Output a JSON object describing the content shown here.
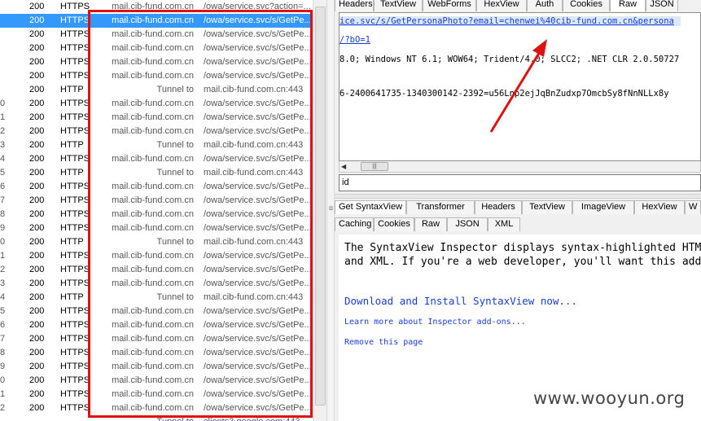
{
  "sessions": [
    {
      "id": "",
      "result": "200",
      "protocol": "HTTPS",
      "host": "mail.cib-fund.com.cn",
      "url": "/owa/service.svc?action=...",
      "selected": false,
      "tunnel": false
    },
    {
      "id": "",
      "result": "200",
      "protocol": "HTTPS",
      "host": "mail.cib-fund.com.cn",
      "url": "/owa/service.svc/s/GetPe...",
      "selected": true,
      "tunnel": false
    },
    {
      "id": "",
      "result": "200",
      "protocol": "HTTPS",
      "host": "mail.cib-fund.com.cn",
      "url": "/owa/service.svc/s/GetPe...",
      "selected": false,
      "tunnel": false
    },
    {
      "id": "",
      "result": "200",
      "protocol": "HTTPS",
      "host": "mail.cib-fund.com.cn",
      "url": "/owa/service.svc/s/GetPe...",
      "selected": false,
      "tunnel": false
    },
    {
      "id": "",
      "result": "200",
      "protocol": "HTTPS",
      "host": "mail.cib-fund.com.cn",
      "url": "/owa/service.svc/s/GetPe...",
      "selected": false,
      "tunnel": false
    },
    {
      "id": "",
      "result": "200",
      "protocol": "HTTPS",
      "host": "mail.cib-fund.com.cn",
      "url": "/owa/service.svc/s/GetPe...",
      "selected": false,
      "tunnel": false
    },
    {
      "id": "",
      "result": "200",
      "protocol": "HTTP",
      "host": "Tunnel to",
      "url": "mail.cib-fund.com.cn:443",
      "selected": false,
      "tunnel": true
    },
    {
      "id": "0",
      "result": "200",
      "protocol": "HTTPS",
      "host": "mail.cib-fund.com.cn",
      "url": "/owa/service.svc/s/GetPe...",
      "selected": false,
      "tunnel": false
    },
    {
      "id": "1",
      "result": "200",
      "protocol": "HTTPS",
      "host": "mail.cib-fund.com.cn",
      "url": "/owa/service.svc/s/GetPe...",
      "selected": false,
      "tunnel": false
    },
    {
      "id": "2",
      "result": "200",
      "protocol": "HTTPS",
      "host": "mail.cib-fund.com.cn",
      "url": "/owa/service.svc/s/GetPe...",
      "selected": false,
      "tunnel": false
    },
    {
      "id": "3",
      "result": "200",
      "protocol": "HTTP",
      "host": "Tunnel to",
      "url": "mail.cib-fund.com.cn:443",
      "selected": false,
      "tunnel": true
    },
    {
      "id": "4",
      "result": "200",
      "protocol": "HTTPS",
      "host": "mail.cib-fund.com.cn",
      "url": "/owa/service.svc/s/GetPe...",
      "selected": false,
      "tunnel": false
    },
    {
      "id": "5",
      "result": "200",
      "protocol": "HTTP",
      "host": "Tunnel to",
      "url": "mail.cib-fund.com.cn:443",
      "selected": false,
      "tunnel": true
    },
    {
      "id": "6",
      "result": "200",
      "protocol": "HTTPS",
      "host": "mail.cib-fund.com.cn",
      "url": "/owa/service.svc/s/GetPe...",
      "selected": false,
      "tunnel": false
    },
    {
      "id": "7",
      "result": "200",
      "protocol": "HTTPS",
      "host": "mail.cib-fund.com.cn",
      "url": "/owa/service.svc/s/GetPe...",
      "selected": false,
      "tunnel": false
    },
    {
      "id": "8",
      "result": "200",
      "protocol": "HTTPS",
      "host": "mail.cib-fund.com.cn",
      "url": "/owa/service.svc/s/GetPe...",
      "selected": false,
      "tunnel": false
    },
    {
      "id": "9",
      "result": "200",
      "protocol": "HTTPS",
      "host": "mail.cib-fund.com.cn",
      "url": "/owa/service.svc/s/GetPe...",
      "selected": false,
      "tunnel": false
    },
    {
      "id": "0",
      "result": "200",
      "protocol": "HTTP",
      "host": "Tunnel to",
      "url": "mail.cib-fund.com.cn:443",
      "selected": false,
      "tunnel": true
    },
    {
      "id": "1",
      "result": "200",
      "protocol": "HTTPS",
      "host": "mail.cib-fund.com.cn",
      "url": "/owa/service.svc/s/GetPe...",
      "selected": false,
      "tunnel": false
    },
    {
      "id": "2",
      "result": "200",
      "protocol": "HTTPS",
      "host": "mail.cib-fund.com.cn",
      "url": "/owa/service.svc/s/GetPe...",
      "selected": false,
      "tunnel": false
    },
    {
      "id": "3",
      "result": "200",
      "protocol": "HTTPS",
      "host": "mail.cib-fund.com.cn",
      "url": "/owa/service.svc/s/GetPe...",
      "selected": false,
      "tunnel": false
    },
    {
      "id": "4",
      "result": "200",
      "protocol": "HTTP",
      "host": "Tunnel to",
      "url": "mail.cib-fund.com.cn:443",
      "selected": false,
      "tunnel": true
    },
    {
      "id": "5",
      "result": "200",
      "protocol": "HTTPS",
      "host": "mail.cib-fund.com.cn",
      "url": "/owa/service.svc/s/GetPe...",
      "selected": false,
      "tunnel": false
    },
    {
      "id": "6",
      "result": "200",
      "protocol": "HTTPS",
      "host": "mail.cib-fund.com.cn",
      "url": "/owa/service.svc/s/GetPe...",
      "selected": false,
      "tunnel": false
    },
    {
      "id": "7",
      "result": "200",
      "protocol": "HTTPS",
      "host": "mail.cib-fund.com.cn",
      "url": "/owa/service.svc/s/GetPe...",
      "selected": false,
      "tunnel": false
    },
    {
      "id": "8",
      "result": "200",
      "protocol": "HTTPS",
      "host": "mail.cib-fund.com.cn",
      "url": "/owa/service.svc/s/GetPe...",
      "selected": false,
      "tunnel": false
    },
    {
      "id": "9",
      "result": "200",
      "protocol": "HTTPS",
      "host": "mail.cib-fund.com.cn",
      "url": "/owa/service.svc/s/GetPe...",
      "selected": false,
      "tunnel": false
    },
    {
      "id": "0",
      "result": "200",
      "protocol": "HTTPS",
      "host": "mail.cib-fund.com.cn",
      "url": "/owa/service.svc/s/GetPe...",
      "selected": false,
      "tunnel": false
    },
    {
      "id": "1",
      "result": "200",
      "protocol": "HTTPS",
      "host": "mail.cib-fund.com.cn",
      "url": "/owa/service.svc/s/GetPe...",
      "selected": false,
      "tunnel": false
    },
    {
      "id": "2",
      "result": "200",
      "protocol": "HTTPS",
      "host": "mail.cib-fund.com.cn",
      "url": "/owa/service.svc/s/GetPe...",
      "selected": false,
      "tunnel": false
    },
    {
      "id": "",
      "result": "",
      "protocol": "",
      "host": "Tunnel to",
      "url": "clients3.google.com:443",
      "selected": false,
      "tunnel": true
    }
  ],
  "top_tabs": [
    "Headers",
    "TextView",
    "WebForms",
    "HexView",
    "Auth",
    "Cookies",
    "Raw",
    "JSON"
  ],
  "top_active_tab": "Raw",
  "response": {
    "line1": "ice.svc/s/GetPersonaPhoto?email=chenwei%40cib-fund.com.cn&persona",
    "line2": "/?bO=1",
    "line3": "8.0; Windows NT 6.1; WOW64; Trident/4.0; SLCC2; .NET CLR 2.0.50727",
    "line4": "6-2400641735-1340300142-2392=u56Lnp2ejJqBnZudxp7OmcbSy8fNnNLLx8y"
  },
  "find_value": "id",
  "lower_tabs_row1": [
    "Get SyntaxView",
    "Transformer",
    "Headers",
    "TextView",
    "ImageView",
    "HexView",
    "W"
  ],
  "lower_tabs_row2": [
    "Caching",
    "Cookies",
    "Raw",
    "JSON",
    "XML"
  ],
  "lower_active_tab": "Get SyntaxView",
  "syntax": {
    "desc_line1": "The SyntaxView Inspector displays syntax-highlighted HTML, Scr",
    "desc_line2": "and XML. If you're a web developer, you'll want this add-on.",
    "download": "Download and Install SyntaxView now...",
    "learn": "Learn more about Inspector add-ons...",
    "remove": "Remove this page"
  },
  "watermark": "www.wooyun.org",
  "colors": {
    "highlight_box": "#e01010",
    "selected_row": "#3399ff",
    "link": "#1a3cd6"
  }
}
